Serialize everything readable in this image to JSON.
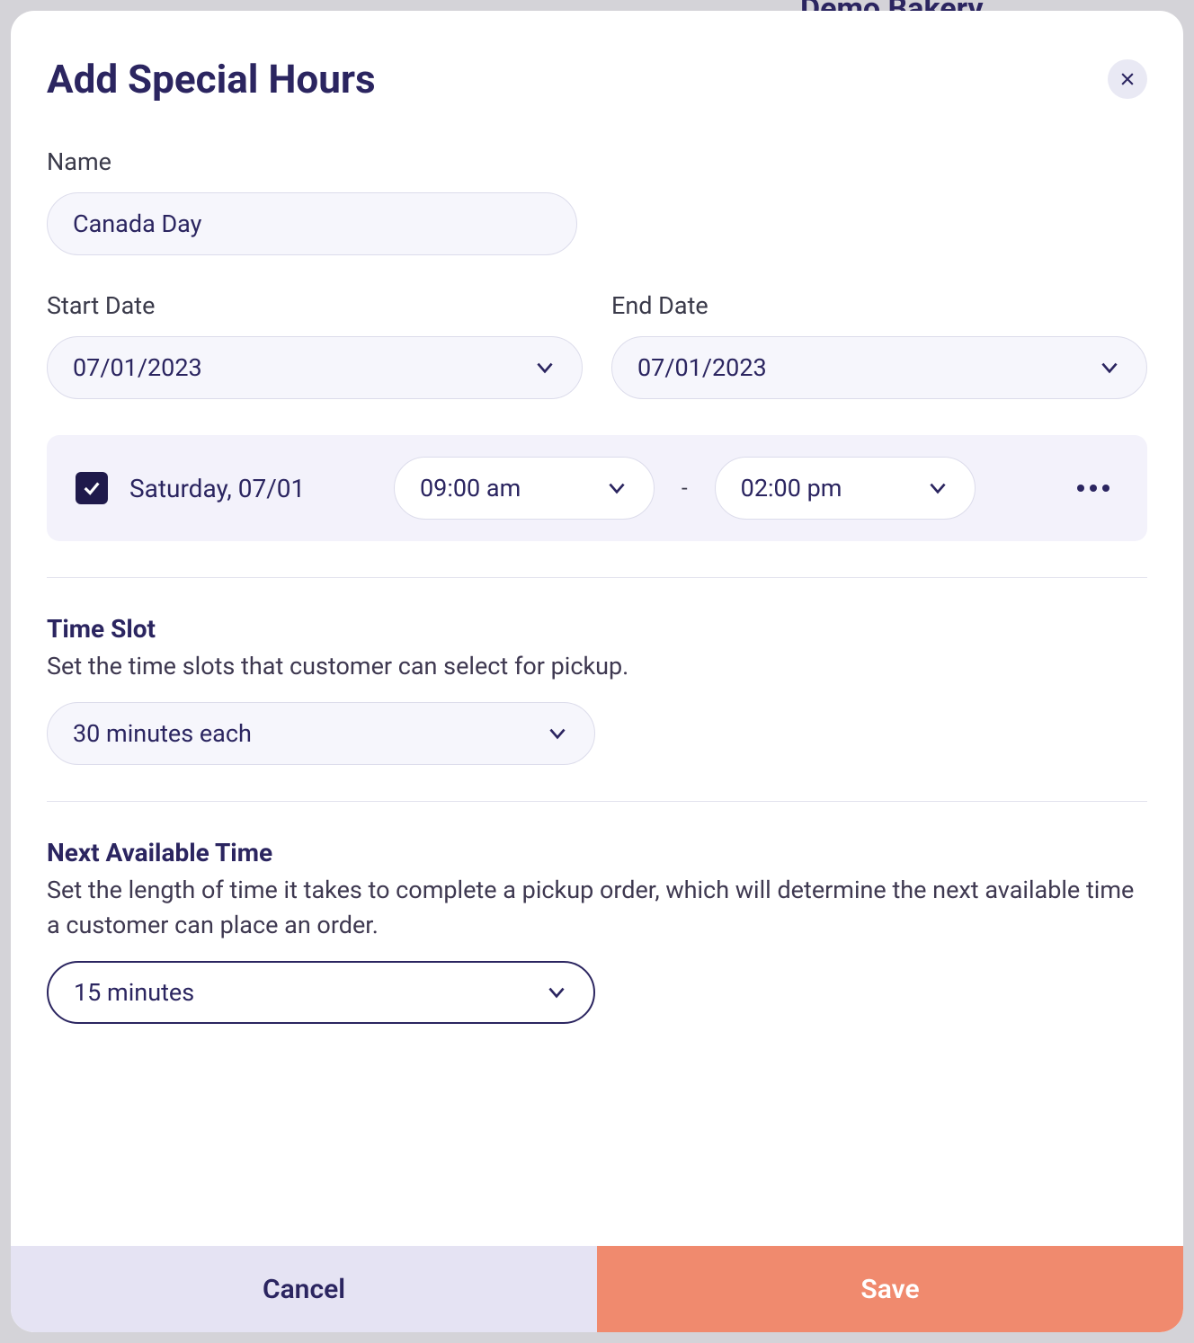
{
  "backdrop": {
    "title": "Demo Bakery"
  },
  "modal": {
    "title": "Add Special Hours",
    "name_label": "Name",
    "name_value": "Canada Day",
    "start_date_label": "Start Date",
    "start_date_value": "07/01/2023",
    "end_date_label": "End Date",
    "end_date_value": "07/01/2023",
    "day": {
      "checked": true,
      "label": "Saturday, 07/01",
      "start_time": "09:00 am",
      "end_time": "02:00 pm",
      "separator": "-"
    },
    "time_slot": {
      "heading": "Time Slot",
      "desc": "Set the time slots that customer can select for pickup.",
      "value": "30 minutes each"
    },
    "next_available": {
      "heading": "Next Available Time",
      "desc": "Set the length of time it takes to complete a pickup order, which will determine the next available time a customer can place an order.",
      "value": "15 minutes"
    },
    "footer": {
      "cancel": "Cancel",
      "save": "Save"
    }
  }
}
